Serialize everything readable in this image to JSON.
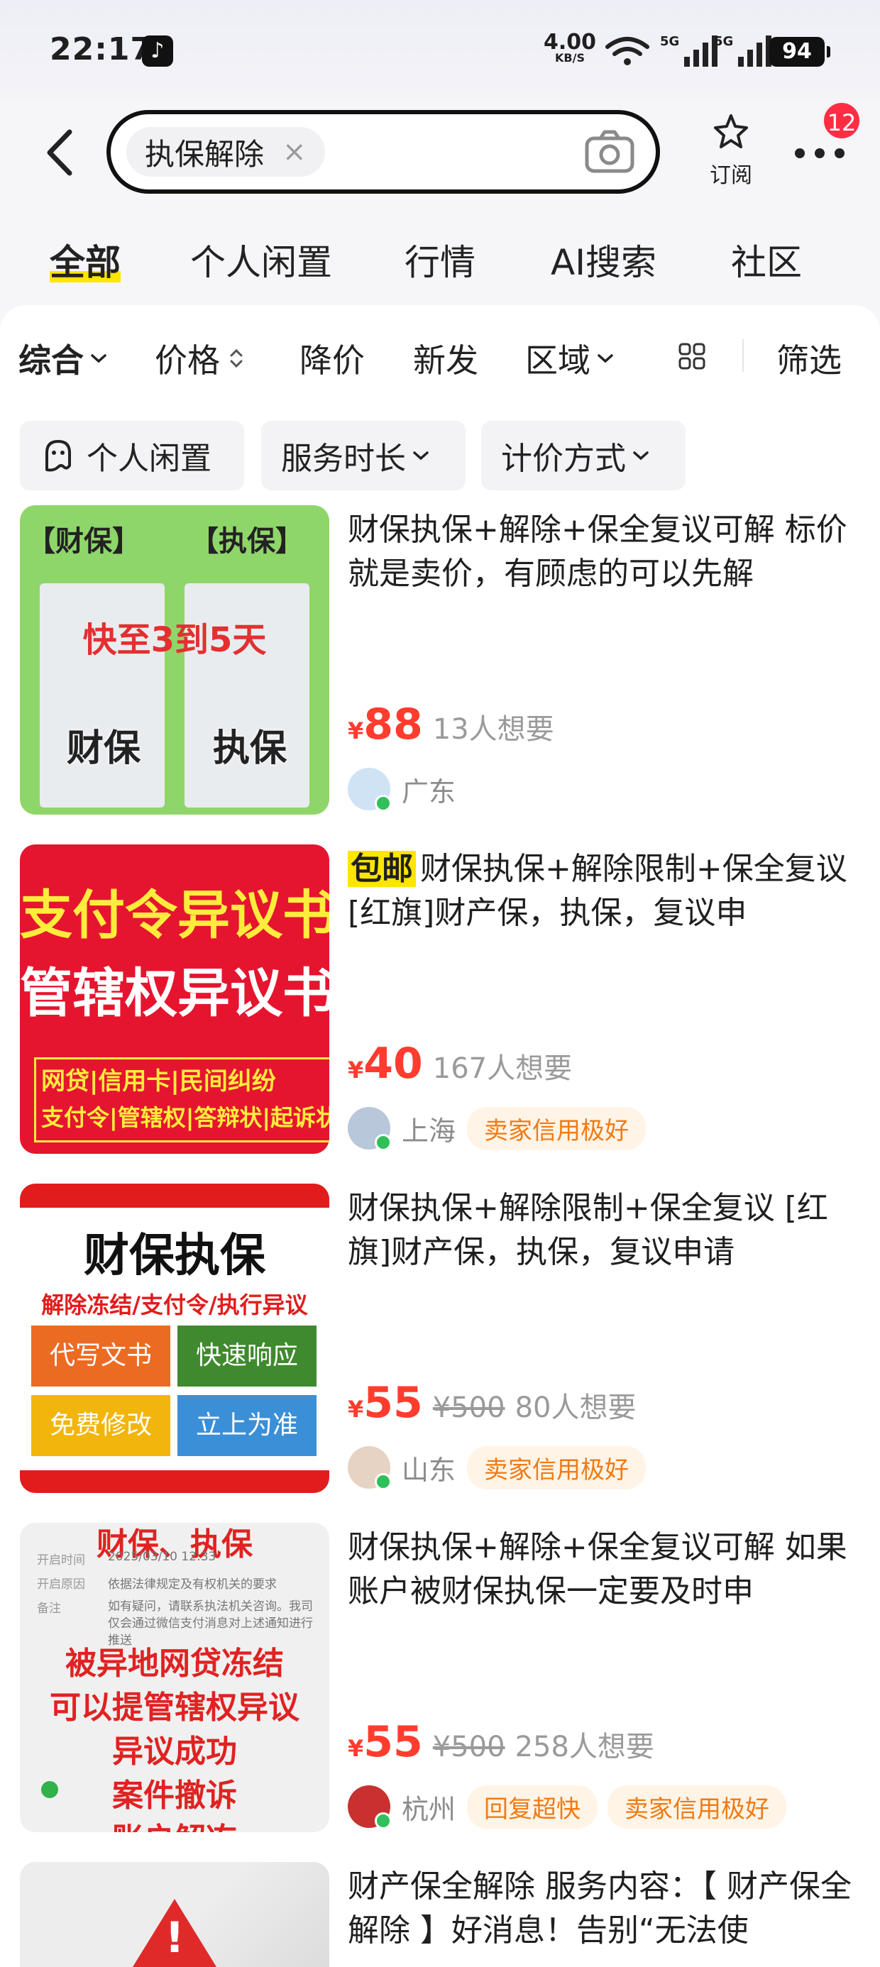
{
  "status_bar": {
    "time": "22:17",
    "net_speed": "4.00",
    "net_unit": "KB/S",
    "sig1_label": "5G",
    "sig2_label": "5G",
    "battery": "94"
  },
  "search": {
    "query": "执保解除",
    "clear_glyph": "×",
    "subscribe_label": "订阅",
    "notification_count": "12"
  },
  "tabs": [
    {
      "label": "全部",
      "active": true
    },
    {
      "label": "个人闲置"
    },
    {
      "label": "行情"
    },
    {
      "label": "AI搜索"
    },
    {
      "label": "社区"
    }
  ],
  "filters": {
    "sort": "综合",
    "price": "价格",
    "price_drop": "降价",
    "new": "新发",
    "region": "区域",
    "screen": "筛选"
  },
  "pills": {
    "personal": "个人闲置",
    "duration": "服务时长",
    "pricing": "计价方式"
  },
  "colors": {
    "accent_yellow": "#ffe500",
    "price_red": "#ff3c2e",
    "tag_orange": "#f07a14",
    "badge_red": "#ff2d44"
  },
  "listings": [
    {
      "title": "财保执保+解除+保全复议可解 标价就是卖价，有顾虑的可以先解",
      "price": "88",
      "currency": "¥",
      "want": "13人想要",
      "location": "广东",
      "image_text": {
        "top_left": "【财保】",
        "top_right": "【执保】",
        "middle": "快至3到5天",
        "bottom_left": "财保",
        "bottom_right": "执保"
      }
    },
    {
      "badge": "包邮",
      "title": "财保执保+解除限制+保全复议 [红旗]财产保，执保，复议申",
      "price": "40",
      "currency": "¥",
      "want": "167人想要",
      "location": "上海",
      "tags": [
        "卖家信用极好"
      ],
      "image_text": {
        "line1": "支付令异议书",
        "line2": "管辖权异议书",
        "box1": "网贷|信用卡|民间纠纷",
        "box2": "支付令|管辖权|答辩状|起诉状"
      }
    },
    {
      "title": "财保执保+解除限制+保全复议 [红旗]财产保，执保，复议申请",
      "price": "55",
      "currency": "¥",
      "original": "¥500",
      "want": "80人想要",
      "location": "山东",
      "tags": [
        "卖家信用极好"
      ],
      "image_text": {
        "heading": "财保执保",
        "sub": "解除冻结/支付令/执行异议",
        "b1": "代写文书",
        "b2": "快速响应",
        "b3": "免费修改",
        "b4": "立上为准"
      }
    },
    {
      "title": "财保执保+解除+保全复议可解 如果账户被财保执保一定要及时申",
      "price": "55",
      "currency": "¥",
      "original": "¥500",
      "want": "258人想要",
      "location": "杭州",
      "tags": [
        "回复超快",
        "卖家信用极好"
      ],
      "image_text": {
        "top": "财保、执保",
        "r1k": "开启时间",
        "r1v": "2025/03/10 12:33",
        "r2k": "开启原因",
        "r2v": "依据法律规定及有权机关的要求",
        "r3k": "备注",
        "r3v": "如有疑问，请联系执法机关咨询。我司仅会通过微信支付消息对上述通知进行推送",
        "red1": "被异地网贷冻结",
        "red2": "可以提管辖权异议",
        "red3": "异议成功",
        "red4": "案件撤诉",
        "red5": "账户解冻"
      }
    },
    {
      "title": "财产保全解除 服务内容：【 财产保全解除 】好消息！告别“无法使",
      "image_text": {
        "mark": "!"
      }
    }
  ]
}
